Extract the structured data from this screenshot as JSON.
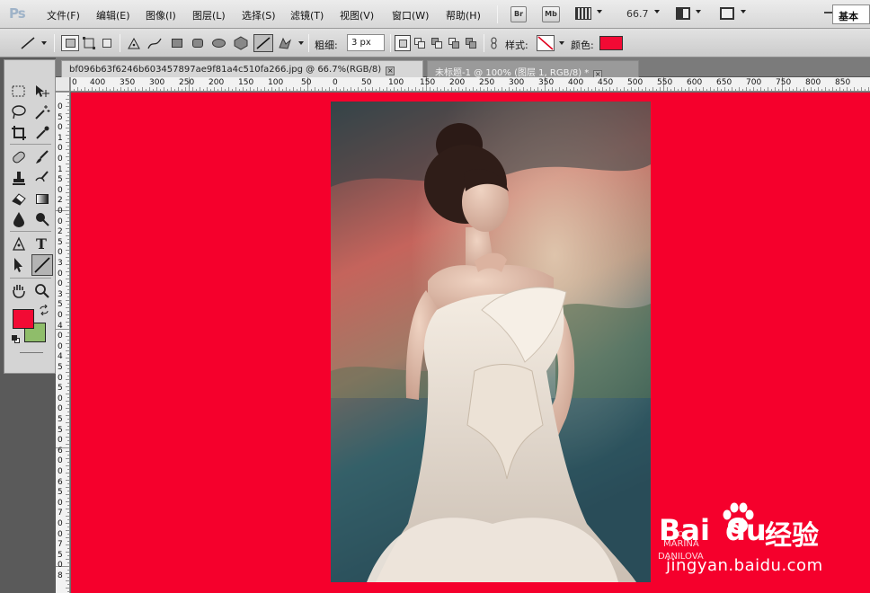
{
  "app": {
    "logo": "Ps"
  },
  "menu": [
    "文件(F)",
    "编辑(E)",
    "图像(I)",
    "图层(L)",
    "选择(S)",
    "滤镜(T)",
    "视图(V)",
    "窗口(W)",
    "帮助(H)"
  ],
  "menubar_buttons": {
    "bridge": "Br",
    "mini_bridge": "Mb",
    "zoom": "66.7",
    "workspace": "基本"
  },
  "options": {
    "weight_label": "粗细:",
    "weight_value": "3 px",
    "style_label": "样式:",
    "color_label": "颜色:",
    "color_swatch": "#f20a34"
  },
  "tabs": [
    {
      "title": "bf096b63f6246b603457897ae9f81a4c510fa266.jpg @ 66.7%(RGB/8)",
      "active": true
    },
    {
      "title": "未标题-1 @ 100% (图层 1, RGB/8) *",
      "active": false
    }
  ],
  "ruler": {
    "h_labels": [
      "0",
      "400",
      "350",
      "300",
      "250",
      "200",
      "150",
      "100",
      "50",
      "0",
      "50",
      "100",
      "150",
      "200",
      "250",
      "300",
      "350",
      "400",
      "450",
      "500",
      "550",
      "600",
      "650",
      "700",
      "750",
      "800",
      "850"
    ],
    "v_labels": [
      "0",
      "5",
      "0",
      "1",
      "0",
      "0",
      "1",
      "5",
      "0",
      "2",
      "0",
      "0",
      "2",
      "5",
      "0",
      "3",
      "0",
      "0",
      "3",
      "5",
      "0",
      "4",
      "0",
      "0",
      "4",
      "5",
      "0",
      "5",
      "0",
      "0",
      "5",
      "5",
      "0",
      "6",
      "0",
      "0",
      "6",
      "5",
      "0",
      "7",
      "0",
      "0",
      "7",
      "5",
      "0",
      "8"
    ]
  },
  "colors": {
    "foreground": "#f20a34",
    "background": "#8fbd6a",
    "canvas": "#f5002c"
  },
  "watermark": {
    "line1": "DO",
    "line2": "MARINA",
    "line3": "DANILOVA"
  },
  "baidu": {
    "logo_bai": "Bai",
    "logo_du": "du",
    "logo_cn": "经验",
    "url": "jingyan.baidu.com"
  }
}
